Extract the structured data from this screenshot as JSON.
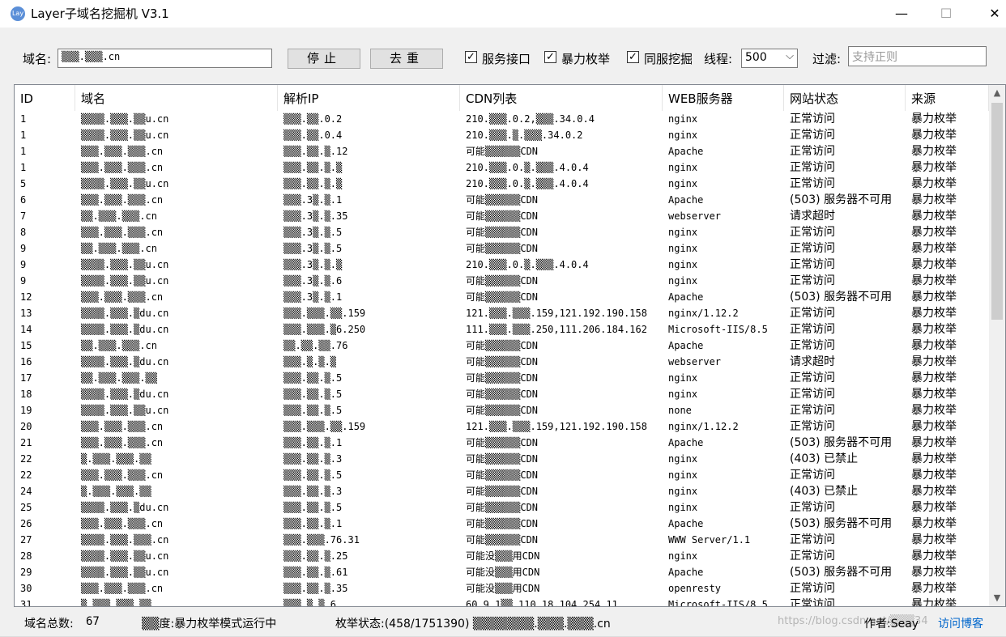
{
  "window": {
    "title": "Layer子域名挖掘机 V3.1",
    "icon_text": "Lay",
    "minimize": "—",
    "maximize": "☐",
    "close": "✕"
  },
  "toolbar": {
    "domain_label": "域名:",
    "domain_value": "▒▒▒.▒▒▒.cn",
    "stop_label": "停止",
    "dedupe_label": "去重",
    "chk_service": {
      "label": "服务接口",
      "checked": true
    },
    "chk_brute": {
      "label": "暴力枚举",
      "checked": true
    },
    "chk_sameserver": {
      "label": "同服挖掘",
      "checked": true
    },
    "threads_label": "线程:",
    "threads_value": "500",
    "filter_label": "过滤:",
    "filter_placeholder": "支持正则"
  },
  "table": {
    "headers": [
      "ID",
      "域名",
      "解析IP",
      "CDN列表",
      "WEB服务器",
      "网站状态",
      "来源"
    ],
    "rows": [
      {
        "id": "1",
        "domain": "▒▒▒▒.▒▒▒.▒▒u.cn",
        "ip": "▒▒▒.▒▒.0.2",
        "cdn": "210.▒▒▒.0.2,▒▒▒.34.0.4",
        "server": "nginx",
        "status": "正常访问",
        "source": "暴力枚举"
      },
      {
        "id": "1",
        "domain": "▒▒▒▒.▒▒▒.▒▒u.cn",
        "ip": "▒▒▒.▒▒.0.4",
        "cdn": "210.▒▒▒.▒.▒▒▒.34.0.2",
        "server": "nginx",
        "status": "正常访问",
        "source": "暴力枚举"
      },
      {
        "id": "1",
        "domain": "▒▒▒.▒▒▒.▒▒▒.cn",
        "ip": "▒▒▒.▒▒.▒.12",
        "cdn": "可能▒▒▒▒▒▒CDN",
        "server": "Apache",
        "status": "正常访问",
        "source": "暴力枚举"
      },
      {
        "id": "1",
        "domain": "▒▒▒.▒▒▒.▒▒▒.cn",
        "ip": "▒▒▒.▒▒.▒.▒",
        "cdn": "210.▒▒▒.0.▒.▒▒▒.4.0.4",
        "server": "nginx",
        "status": "正常访问",
        "source": "暴力枚举"
      },
      {
        "id": "5",
        "domain": "▒▒▒▒.▒▒▒.▒▒u.cn",
        "ip": "▒▒▒.▒▒.▒.▒",
        "cdn": "210.▒▒▒.0.▒.▒▒▒.4.0.4",
        "server": "nginx",
        "status": "正常访问",
        "source": "暴力枚举"
      },
      {
        "id": "6",
        "domain": "▒▒▒.▒▒▒.▒▒▒.cn",
        "ip": "▒▒▒.3▒.▒.1",
        "cdn": "可能▒▒▒▒▒▒CDN",
        "server": "Apache",
        "status": "(503) 服务器不可用",
        "source": "暴力枚举"
      },
      {
        "id": "7",
        "domain": "▒▒.▒▒▒.▒▒▒.cn",
        "ip": "▒▒▒.3▒.▒.35",
        "cdn": "可能▒▒▒▒▒▒CDN",
        "server": "webserver",
        "status": "请求超时",
        "source": "暴力枚举"
      },
      {
        "id": "8",
        "domain": "▒▒▒.▒▒▒.▒▒▒.cn",
        "ip": "▒▒▒.3▒.▒.5",
        "cdn": "可能▒▒▒▒▒▒CDN",
        "server": "nginx",
        "status": "正常访问",
        "source": "暴力枚举"
      },
      {
        "id": "9",
        "domain": "▒▒.▒▒▒.▒▒▒.cn",
        "ip": "▒▒▒.3▒.▒.5",
        "cdn": "可能▒▒▒▒▒▒CDN",
        "server": "nginx",
        "status": "正常访问",
        "source": "暴力枚举"
      },
      {
        "id": "9",
        "domain": "▒▒▒▒.▒▒▒.▒▒u.cn",
        "ip": "▒▒▒.3▒.▒.▒",
        "cdn": "210.▒▒▒.0.▒.▒▒▒.4.0.4",
        "server": "nginx",
        "status": "正常访问",
        "source": "暴力枚举"
      },
      {
        "id": "9",
        "domain": "▒▒▒▒.▒▒▒.▒▒u.cn",
        "ip": "▒▒▒.3▒.▒.6",
        "cdn": "可能▒▒▒▒▒▒CDN",
        "server": "nginx",
        "status": "正常访问",
        "source": "暴力枚举"
      },
      {
        "id": "12",
        "domain": "▒▒▒.▒▒▒.▒▒▒.cn",
        "ip": "▒▒▒.3▒.▒.1",
        "cdn": "可能▒▒▒▒▒▒CDN",
        "server": "Apache",
        "status": "(503) 服务器不可用",
        "source": "暴力枚举"
      },
      {
        "id": "13",
        "domain": "▒▒▒▒.▒▒▒.▒du.cn",
        "ip": "▒▒▒.▒▒▒.▒▒.159",
        "cdn": "121.▒▒▒.▒▒▒.159,121.192.190.158",
        "server": "nginx/1.12.2",
        "status": "正常访问",
        "source": "暴力枚举"
      },
      {
        "id": "14",
        "domain": "▒▒▒▒.▒▒▒.▒du.cn",
        "ip": "▒▒▒.▒▒▒.▒6.250",
        "cdn": "111.▒▒▒.▒▒▒.250,111.206.184.162",
        "server": "Microsoft-IIS/8.5",
        "status": "正常访问",
        "source": "暴力枚举"
      },
      {
        "id": "15",
        "domain": "▒▒.▒▒▒.▒▒▒.cn",
        "ip": "▒▒.▒▒.▒▒.76",
        "cdn": "可能▒▒▒▒▒▒CDN",
        "server": "Apache",
        "status": "正常访问",
        "source": "暴力枚举"
      },
      {
        "id": "16",
        "domain": "▒▒▒▒.▒▒▒.▒du.cn",
        "ip": "▒▒▒.▒.▒.▒",
        "cdn": "可能▒▒▒▒▒▒CDN",
        "server": "webserver",
        "status": "请求超时",
        "source": "暴力枚举"
      },
      {
        "id": "17",
        "domain": "▒▒.▒▒▒.▒▒▒.▒▒",
        "ip": "▒▒▒.▒▒.▒.5",
        "cdn": "可能▒▒▒▒▒▒CDN",
        "server": "nginx",
        "status": "正常访问",
        "source": "暴力枚举"
      },
      {
        "id": "18",
        "domain": "▒▒▒▒.▒▒▒.▒du.cn",
        "ip": "▒▒▒.▒▒.▒.5",
        "cdn": "可能▒▒▒▒▒▒CDN",
        "server": "nginx",
        "status": "正常访问",
        "source": "暴力枚举"
      },
      {
        "id": "19",
        "domain": "▒▒▒▒.▒▒▒.▒▒u.cn",
        "ip": "▒▒▒.▒▒.▒.5",
        "cdn": "可能▒▒▒▒▒▒CDN",
        "server": "none",
        "status": "正常访问",
        "source": "暴力枚举"
      },
      {
        "id": "20",
        "domain": "▒▒▒.▒▒▒.▒▒▒.cn",
        "ip": "▒▒▒.▒▒▒.▒▒.159",
        "cdn": "121.▒▒▒.▒▒▒.159,121.192.190.158",
        "server": "nginx/1.12.2",
        "status": "正常访问",
        "source": "暴力枚举"
      },
      {
        "id": "21",
        "domain": "▒▒▒.▒▒▒.▒▒▒.cn",
        "ip": "▒▒▒.▒▒.▒.1",
        "cdn": "可能▒▒▒▒▒▒CDN",
        "server": "Apache",
        "status": "(503) 服务器不可用",
        "source": "暴力枚举"
      },
      {
        "id": "22",
        "domain": "▒.▒▒▒.▒▒▒.▒▒",
        "ip": "▒▒▒.▒▒.▒.3",
        "cdn": "可能▒▒▒▒▒▒CDN",
        "server": "nginx",
        "status": "(403) 已禁止",
        "source": "暴力枚举"
      },
      {
        "id": "22",
        "domain": "▒▒▒.▒▒▒.▒▒▒.cn",
        "ip": "▒▒▒.▒▒.▒.5",
        "cdn": "可能▒▒▒▒▒▒CDN",
        "server": "nginx",
        "status": "正常访问",
        "source": "暴力枚举"
      },
      {
        "id": "24",
        "domain": "▒.▒▒▒.▒▒▒.▒▒",
        "ip": "▒▒▒.▒▒.▒.3",
        "cdn": "可能▒▒▒▒▒▒CDN",
        "server": "nginx",
        "status": "(403) 已禁止",
        "source": "暴力枚举"
      },
      {
        "id": "25",
        "domain": "▒▒▒▒.▒▒▒.▒du.cn",
        "ip": "▒▒▒.▒▒.▒.5",
        "cdn": "可能▒▒▒▒▒▒CDN",
        "server": "nginx",
        "status": "正常访问",
        "source": "暴力枚举"
      },
      {
        "id": "26",
        "domain": "▒▒▒.▒▒▒.▒▒▒.cn",
        "ip": "▒▒▒.▒▒.▒.1",
        "cdn": "可能▒▒▒▒▒▒CDN",
        "server": "Apache",
        "status": "(503) 服务器不可用",
        "source": "暴力枚举"
      },
      {
        "id": "27",
        "domain": "▒▒▒▒.▒▒▒.▒▒▒.cn",
        "ip": "▒▒▒.▒▒▒.76.31",
        "cdn": "可能▒▒▒▒▒▒CDN",
        "server": "WWW Server/1.1",
        "status": "正常访问",
        "source": "暴力枚举"
      },
      {
        "id": "28",
        "domain": "▒▒▒▒.▒▒▒.▒▒u.cn",
        "ip": "▒▒▒.▒▒.▒.25",
        "cdn": "可能没▒▒▒用CDN",
        "server": "nginx",
        "status": "正常访问",
        "source": "暴力枚举"
      },
      {
        "id": "29",
        "domain": "▒▒▒▒.▒▒▒.▒▒u.cn",
        "ip": "▒▒▒.▒▒.▒.61",
        "cdn": "可能没▒▒▒用CDN",
        "server": "Apache",
        "status": "(503) 服务器不可用",
        "source": "暴力枚举"
      },
      {
        "id": "30",
        "domain": "▒▒▒.▒▒▒.▒▒▒.cn",
        "ip": "▒▒▒.▒▒.▒.35",
        "cdn": "可能没▒▒▒用CDN",
        "server": "openresty",
        "status": "正常访问",
        "source": "暴力枚举"
      },
      {
        "id": "31",
        "domain": "▒.▒▒▒.▒▒▒.▒▒",
        "ip": "▒▒▒.▒.▒.6",
        "cdn": "60.9.1▒▒.110.18,104.254.11",
        "server": "Microsoft-IIS/8.5",
        "status": "正常访问",
        "source": "暴力枚举"
      }
    ]
  },
  "statusbar": {
    "total_label": "域名总数:",
    "total_value": "67",
    "progress_text": "▒▒度:暴力枚举模式运行中",
    "enum_status_text": "枚举状态:(458/1751390) ▒▒▒▒▒▒▒.▒▒▒.▒▒▒.cn",
    "author_text": "作者:Seay",
    "blog_link": "访问博客",
    "watermark": "https://blog.csdn.net/▒▒▒34"
  },
  "scroll": {
    "up": "▲",
    "down": "▼"
  },
  "colors": {
    "link": "#0066cc",
    "window_bg": "#f0f0f0",
    "grid_bg": "#ffffff"
  }
}
